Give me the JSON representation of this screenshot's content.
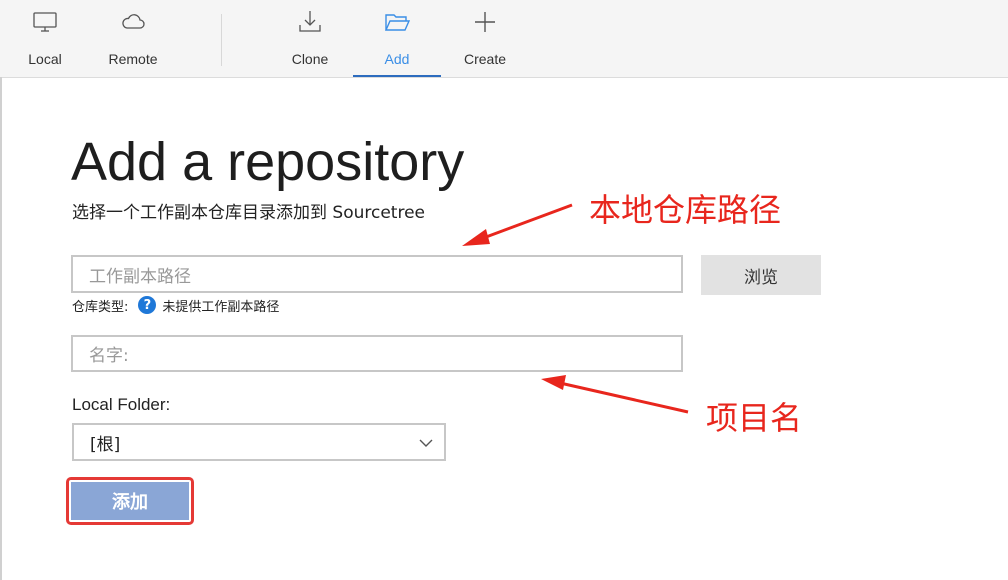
{
  "toolbar": {
    "local_label": "Local",
    "remote_label": "Remote",
    "clone_label": "Clone",
    "add_label": "Add",
    "create_label": "Create"
  },
  "main": {
    "title": "Add a repository",
    "subtitle": "选择一个工作副本仓库目录添加到 Sourcetree",
    "path_placeholder": "工作副本路径",
    "browse_label": "浏览",
    "repo_type_label": "仓库类型:",
    "repo_type_value": "未提供工作副本路径",
    "name_placeholder": "名字:",
    "local_folder_label": "Local Folder:",
    "local_folder_value": "[根]",
    "add_button_label": "添加"
  },
  "annotations": {
    "path_note": "本地仓库路径",
    "name_note": "项目名"
  },
  "colors": {
    "accent": "#3a8ee6",
    "annotation": "#e8261d",
    "add_button": "#8aa6d6"
  }
}
